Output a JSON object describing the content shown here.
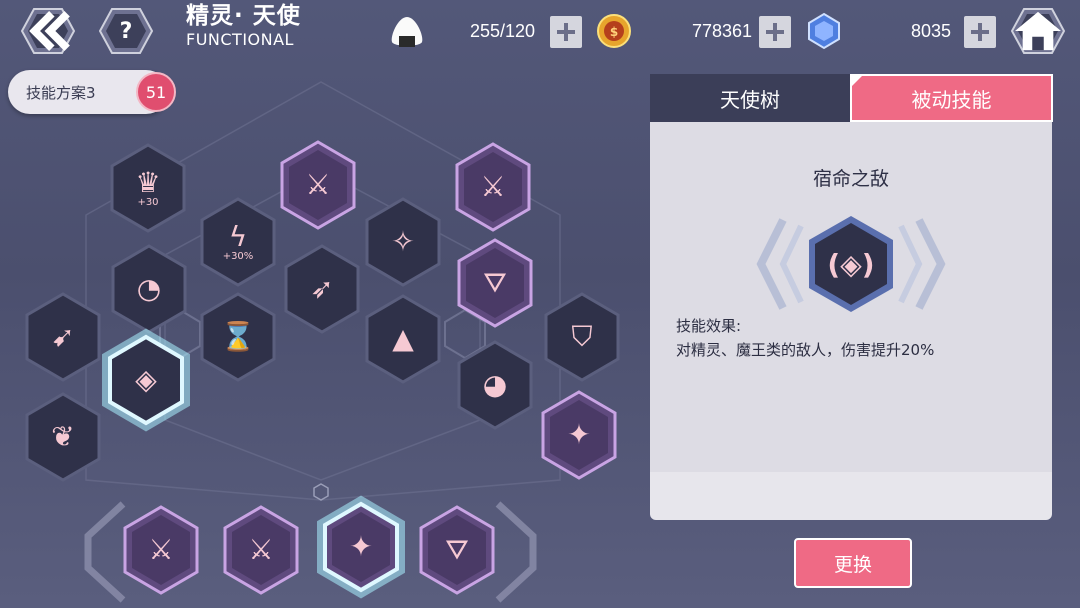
{
  "header": {
    "back_icon": "chevron-left-icon",
    "help_icon": "question-icon",
    "title_cn": "精灵· 天使",
    "title_en": "FUNCTIONAL",
    "stamina_icon": "rice-ball-icon",
    "stamina": "255/120",
    "gold_icon": "gold-coin-icon",
    "gold": "778361",
    "gem_icon": "blue-crystal-icon",
    "gems": "8035",
    "home_icon": "home-icon"
  },
  "plan": {
    "label": "技能方案3",
    "points": "51"
  },
  "tabs": {
    "tree": "天使树",
    "passive": "被动技能"
  },
  "selected_skill": {
    "name": "宿命之敌",
    "effect_title": "技能效果:",
    "effect_text": "对精灵、魔王类的敌人，伤害提升20%"
  },
  "swap_button": "更换",
  "tree_nodes": [
    {
      "id": "n1",
      "icon": "angel-portrait-icon",
      "badge": "+30",
      "highlight": false
    },
    {
      "id": "n2",
      "icon": "angel-wing-icon",
      "badge": "",
      "highlight": true
    },
    {
      "id": "n3",
      "icon": "angel-wing-icon",
      "badge": "",
      "highlight": true
    },
    {
      "id": "n4",
      "icon": "lightning-burst-icon",
      "badge": "+30%",
      "highlight": false
    },
    {
      "id": "n5",
      "icon": "star-constellation-icon",
      "badge": "",
      "highlight": false
    },
    {
      "id": "n6",
      "icon": "dotted-circle-sword-icon",
      "badge": "",
      "highlight": false
    },
    {
      "id": "n7",
      "icon": "kick-icon",
      "badge": "",
      "highlight": false
    },
    {
      "id": "n8",
      "icon": "lightning-triangle-icon",
      "badge": "",
      "highlight": true
    },
    {
      "id": "n9",
      "icon": "dash-icon",
      "badge": "",
      "highlight": false
    },
    {
      "id": "n10",
      "icon": "bow-timer-icon",
      "badge": "",
      "highlight": false
    },
    {
      "id": "n11",
      "icon": "blade-pyramid-icon",
      "badge": "",
      "highlight": false
    },
    {
      "id": "n12",
      "icon": "lightning-shield-icon",
      "badge": "",
      "highlight": false
    },
    {
      "id": "n13",
      "icon": "nemesis-mask-icon",
      "badge": "",
      "highlight": false,
      "selected": true
    },
    {
      "id": "n14",
      "icon": "dotted-circle-wing-icon",
      "badge": "",
      "highlight": false
    },
    {
      "id": "n15",
      "icon": "wing-cloak-icon",
      "badge": "",
      "highlight": false
    },
    {
      "id": "n16",
      "icon": "winged-warrior-icon",
      "badge": "",
      "highlight": true
    }
  ],
  "equipped_slots": [
    {
      "icon": "angel-wing-icon",
      "selected": false
    },
    {
      "icon": "angel-wing-icon",
      "selected": false
    },
    {
      "icon": "winged-warrior-icon",
      "selected": true
    },
    {
      "icon": "lightning-triangle-icon",
      "selected": false
    }
  ],
  "colors": {
    "accent": "#ef6a85",
    "node_fill": "#2f3149",
    "node_highlight": "#6a4a86",
    "glow": "#a9f0ff"
  }
}
